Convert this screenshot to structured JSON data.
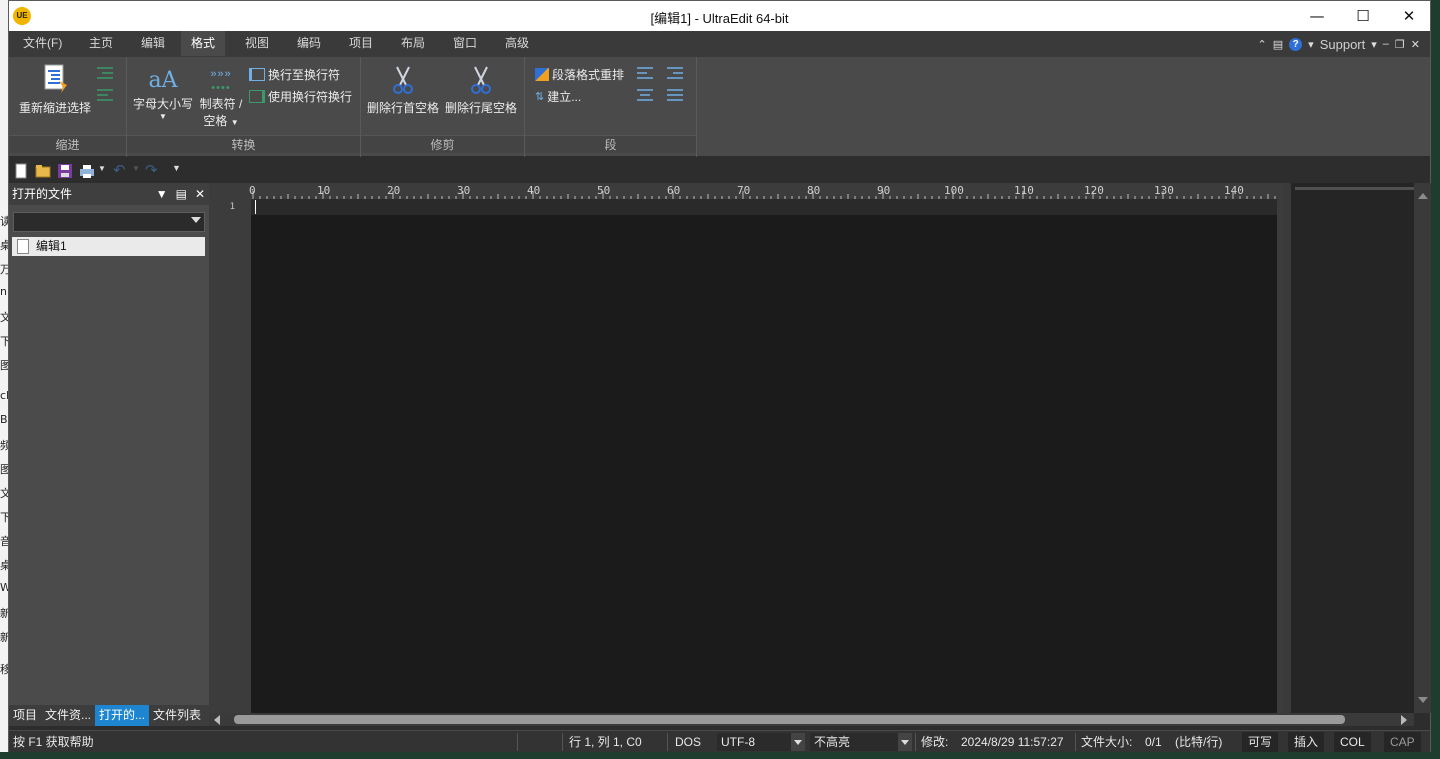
{
  "background_peek": [
    "读",
    "桌",
    "万",
    "ni",
    "文",
    "下",
    "图",
    "cF",
    "Bl",
    "频",
    "图",
    "文",
    "下",
    "音",
    "桌",
    "W",
    "新",
    "新",
    "移"
  ],
  "window": {
    "title": "[编辑1] - UltraEdit 64-bit",
    "logo": "UE",
    "minimize": "—",
    "maximize": "☐",
    "close": "✕"
  },
  "ribbon": {
    "tabs": [
      "文件(F)",
      "主页",
      "编辑",
      "格式",
      "视图",
      "编码",
      "项目",
      "布局",
      "窗口",
      "高级"
    ],
    "active_tab": "格式",
    "support_label": "Support",
    "groups": {
      "indent": {
        "label": "缩进",
        "reindent_selection": "重新缩进选择"
      },
      "convert": {
        "label": "转换",
        "case": "字母大小写",
        "tabs_spaces_line1": "制表符 /",
        "tabs_spaces_line2": "空格",
        "wrap_to_cr": "换行至换行符",
        "cr_to_wrap": "使用换行符换行"
      },
      "trim": {
        "label": "修剪",
        "trim_leading": "删除行首空格",
        "trim_trailing": "删除行尾空格"
      },
      "paragraph": {
        "label": "段",
        "reformat": "段落格式重排",
        "create": "建立..."
      }
    }
  },
  "side_panel": {
    "title": "打开的文件",
    "files": [
      "编辑1"
    ],
    "tabs": [
      "项目",
      "文件资...",
      "打开的...",
      "文件列表"
    ],
    "active_tab": "打开的..."
  },
  "editor": {
    "line_numbers": [
      "1"
    ],
    "ruler_marks": [
      "0",
      "10",
      "20",
      "30",
      "40",
      "50",
      "60",
      "70",
      "80",
      "90",
      "100",
      "110",
      "120",
      "130",
      "140"
    ]
  },
  "status_bar": {
    "help": "按 F1 获取帮助",
    "position": "行 1, 列 1, C0",
    "line_ending": "DOS",
    "encoding": "UTF-8",
    "highlight": "不高亮",
    "modified_label": "修改:",
    "modified_value": "2024/8/29 11:57:27",
    "file_size_label": "文件大小:",
    "file_size_value": "0/1",
    "file_size_unit": "(比特/行)",
    "writable": "可写",
    "insert": "插入",
    "col": "COL",
    "cap": "CAP"
  },
  "colors": {
    "accent": "#1e86d0",
    "ribbon_bg": "#4a4a4a",
    "editor_bg": "#1b1b1b",
    "logo": "#f1b500"
  }
}
